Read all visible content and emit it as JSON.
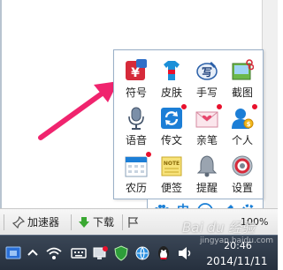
{
  "ime_toolbox": {
    "tools": [
      {
        "label": "符号",
        "icon": "rmb-symbol-icon"
      },
      {
        "label": "皮肤",
        "icon": "tshirt-skin-icon"
      },
      {
        "label": "手写",
        "icon": "handwriting-icon"
      },
      {
        "label": "截图",
        "icon": "screenshot-scissors-icon"
      },
      {
        "label": "语音",
        "icon": "microphone-icon"
      },
      {
        "label": "传文",
        "icon": "sync-transfer-icon"
      },
      {
        "label": "亲笔",
        "icon": "envelope-heart-icon"
      },
      {
        "label": "个人",
        "icon": "person-coin-icon"
      },
      {
        "label": "农历",
        "icon": "calendar-icon"
      },
      {
        "label": "便签",
        "icon": "note-icon"
      },
      {
        "label": "提醒",
        "icon": "bell-icon"
      },
      {
        "label": "设置",
        "icon": "gear-settings-icon"
      }
    ]
  },
  "ime_status": {
    "mode_label": "中"
  },
  "app_toolbar": {
    "accelerator_label": "加速器",
    "download_label": "下载",
    "zoom_label": "100%"
  },
  "taskbar": {
    "time": "20:46",
    "date": "2014/11/11"
  },
  "watermark": {
    "text": "Bai du 经验",
    "url": "jingyan.baidu.com"
  },
  "colors": {
    "arrow": "#f0246e",
    "panel_border": "#9ab0c8",
    "ime_blue": "#1a7fd6",
    "badge_red": "#e8102c",
    "taskbar": "#2e3846"
  }
}
